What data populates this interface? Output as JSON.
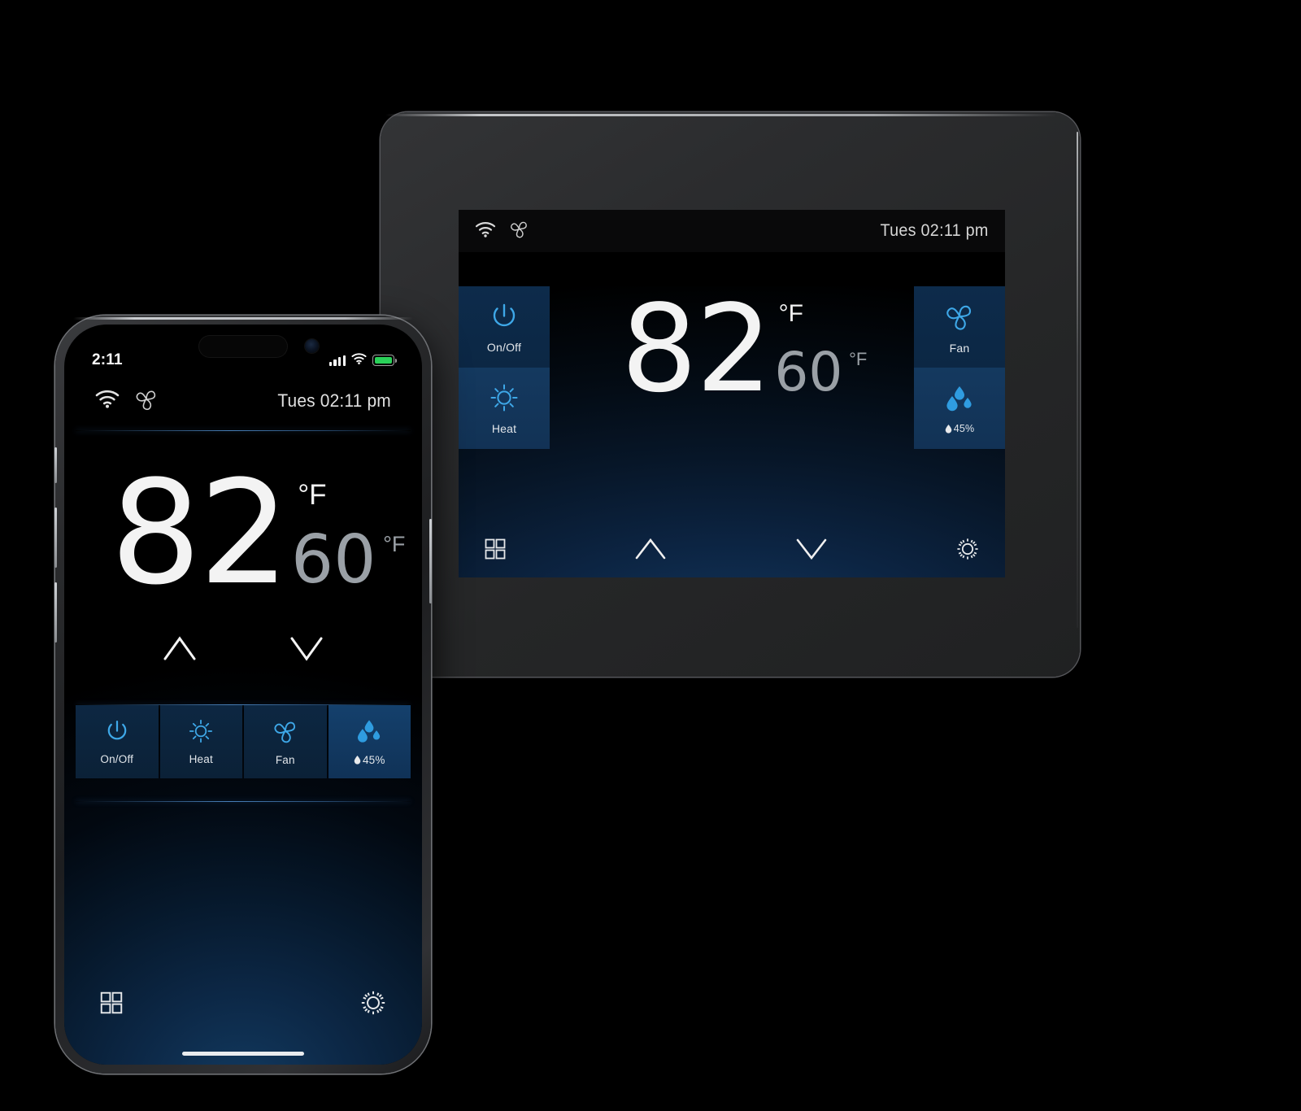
{
  "theme": {
    "background": "#000000",
    "accent_blue": "#3ea8e8",
    "tile_blue": "#0d2b4b",
    "tile_blue_active": "#14395f",
    "temp_white": "#f3f3f3",
    "setpoint_gray": "#9aa0a6",
    "battery_green": "#2ad159"
  },
  "tablet": {
    "device_name": "wall-thermostat-tablet",
    "status_bar": {
      "wifi_icon": "wifi-icon",
      "fan_icon": "fan-icon",
      "clock": "Tues 02:11 pm"
    },
    "temperature": {
      "current": "82",
      "current_unit": "°F",
      "setpoint": "60",
      "setpoint_unit": "°F"
    },
    "left_tiles": [
      {
        "id": "on-off",
        "label": "On/Off",
        "icon": "power-icon",
        "active": false
      },
      {
        "id": "heat",
        "label": "Heat",
        "icon": "sun-icon",
        "active": true
      }
    ],
    "right_tiles": [
      {
        "id": "fan",
        "label": "Fan",
        "icon": "fan-blade-icon",
        "active": false
      },
      {
        "id": "humidity",
        "label": "45%",
        "icon": "water-drops-icon",
        "active": true
      }
    ],
    "nav": {
      "menu_label": "menu",
      "up_label": "increase",
      "down_label": "decrease",
      "settings_label": "settings"
    }
  },
  "phone": {
    "device_name": "smartphone",
    "ios_status": {
      "time": "2:11",
      "signal_icon": "cellular-signal-icon",
      "wifi_icon": "wifi-icon",
      "battery_icon": "battery-full-icon"
    },
    "app_status_bar": {
      "wifi_icon": "wifi-icon",
      "fan_icon": "fan-icon",
      "clock": "Tues 02:11 pm"
    },
    "temperature": {
      "current": "82",
      "current_unit": "°F",
      "setpoint": "60",
      "setpoint_unit": "°F"
    },
    "tiles": [
      {
        "id": "on-off",
        "label": "On/Off",
        "icon": "power-icon",
        "active": false
      },
      {
        "id": "heat",
        "label": "Heat",
        "icon": "sun-icon",
        "active": false
      },
      {
        "id": "fan",
        "label": "Fan",
        "icon": "fan-blade-icon",
        "active": false
      },
      {
        "id": "humidity",
        "label": "45%",
        "icon": "water-drops-icon",
        "active": true
      }
    ],
    "nav": {
      "menu_label": "menu",
      "up_label": "increase",
      "down_label": "decrease",
      "settings_label": "settings"
    }
  }
}
